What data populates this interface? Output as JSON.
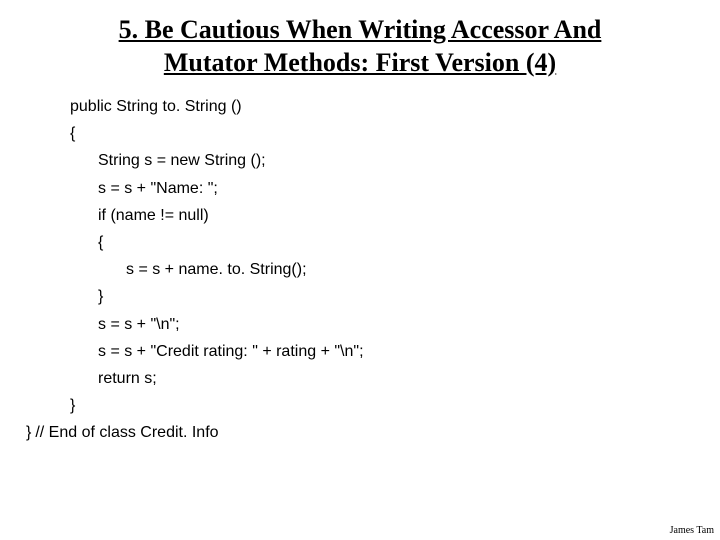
{
  "title": "5. Be Cautious When Writing Accessor And Mutator Methods: First Version (4)",
  "code": {
    "line1": "public String to. String ()",
    "line2": "{",
    "line3": "String s = new String ();",
    "line4": "s = s + \"Name: \";",
    "line5": "if (name != null)",
    "line6": "{",
    "line7": "s = s + name. to. String();",
    "line8": "}",
    "line9": "s = s + \"\\n\";",
    "line10": "s = s + \"Credit rating: \" + rating + \"\\n\";",
    "line11": "return s;",
    "line12": "}",
    "line13a": "}",
    "line13b": "// End of class Credit. Info"
  },
  "footer": "James Tam"
}
